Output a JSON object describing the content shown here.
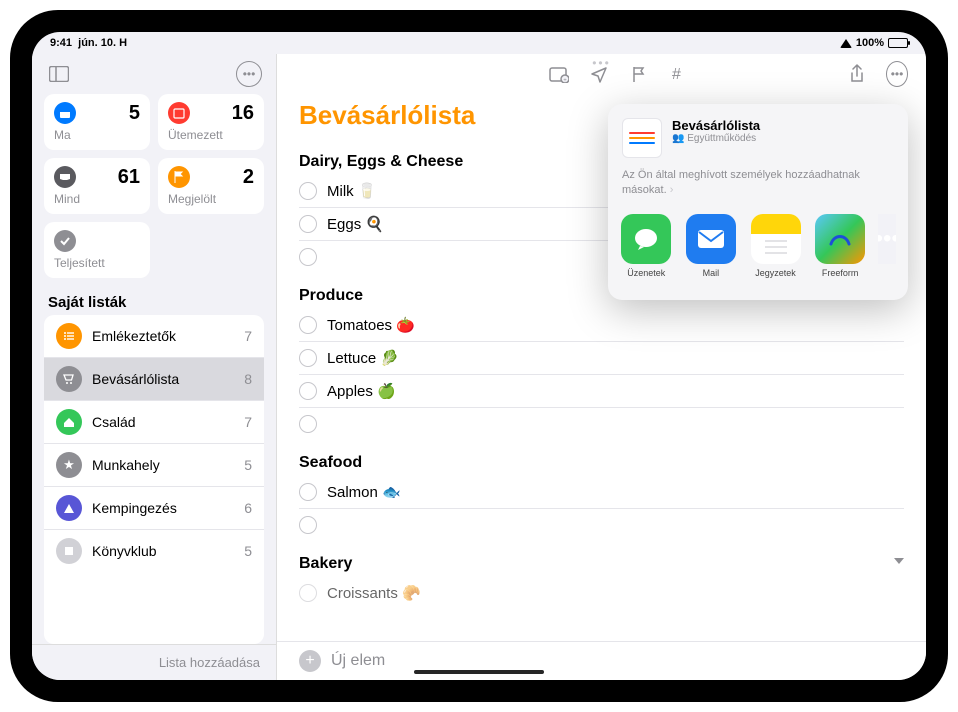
{
  "status": {
    "time": "9:41",
    "date": "jún. 10. H",
    "battery": "100%"
  },
  "sidebar": {
    "cards": [
      {
        "label": "Ma",
        "count": "5"
      },
      {
        "label": "Ütemezett",
        "count": "16"
      },
      {
        "label": "Mind",
        "count": "61"
      },
      {
        "label": "Megjelölt",
        "count": "2"
      }
    ],
    "completed_label": "Teljesített",
    "lists_heading": "Saját listák",
    "lists": [
      {
        "name": "Emlékeztetők",
        "count": "7",
        "color": "#ff9500"
      },
      {
        "name": "Bevásárlólista",
        "count": "8",
        "color": "#8e8e93"
      },
      {
        "name": "Család",
        "count": "7",
        "color": "#34c759"
      },
      {
        "name": "Munkahely",
        "count": "5",
        "color": "#8e8e93"
      },
      {
        "name": "Kempingezés",
        "count": "6",
        "color": "#5856d6"
      },
      {
        "name": "Könyvklub",
        "count": "5",
        "color": "#d1d1d6"
      }
    ],
    "add_list": "Lista hozzáadása"
  },
  "main": {
    "title": "Bevásárlólista",
    "sections": [
      {
        "heading": "Dairy, Eggs & Cheese",
        "items": [
          "Milk 🥛",
          "Eggs 🍳"
        ]
      },
      {
        "heading": "Produce",
        "items": [
          "Tomatoes 🍅",
          "Lettuce 🥬",
          "Apples 🍏"
        ]
      },
      {
        "heading": "Seafood",
        "items": [
          "Salmon 🐟"
        ]
      },
      {
        "heading": "Bakery",
        "items": [
          "Croissants 🥐"
        ]
      }
    ],
    "new_item": "Új elem"
  },
  "share": {
    "title": "Bevásárlólista",
    "subtitle": "Együttműködés",
    "info": "Az Ön által meghívott személyek hozzáadhatnak másokat.",
    "apps": [
      {
        "name": "Üzenetek"
      },
      {
        "name": "Mail"
      },
      {
        "name": "Jegyzetek"
      },
      {
        "name": "Freeform"
      }
    ]
  }
}
